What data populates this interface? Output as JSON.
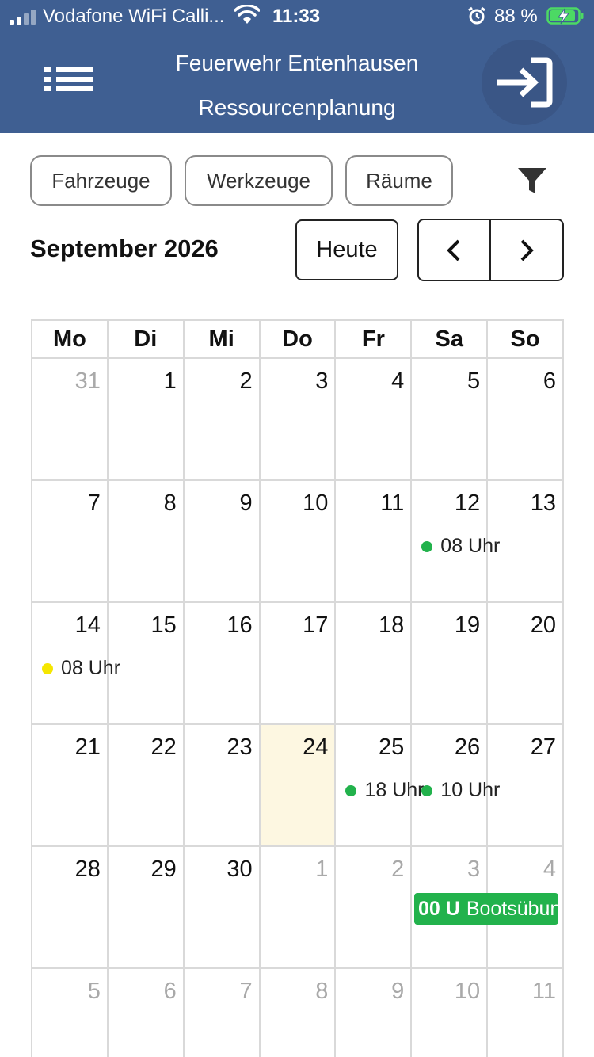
{
  "status_bar": {
    "carrier": "Vodafone WiFi Calli...",
    "time": "11:33",
    "battery": "88 %"
  },
  "header": {
    "org_name": "Feuerwehr Entenhausen",
    "app_title": "Ressourcenplanung",
    "icons": {
      "menu": "list-icon",
      "login": "sign-in-icon"
    },
    "color": "#3f5f92"
  },
  "filters": {
    "chips": [
      "Fahrzeuge",
      "Werkzeuge",
      "Räume"
    ],
    "filter_icon": "funnel-icon"
  },
  "calendar": {
    "month_label": "September 2026",
    "today_button": "Heute",
    "weekdays": [
      "Mo",
      "Di",
      "Mi",
      "Do",
      "Fr",
      "Sa",
      "So"
    ],
    "weeks": [
      [
        "31",
        "1",
        "2",
        "3",
        "4",
        "5",
        "6"
      ],
      [
        "7",
        "8",
        "9",
        "10",
        "11",
        "12",
        "13"
      ],
      [
        "14",
        "15",
        "16",
        "17",
        "18",
        "19",
        "20"
      ],
      [
        "21",
        "22",
        "23",
        "24",
        "25",
        "26",
        "27"
      ],
      [
        "28",
        "29",
        "30",
        "1",
        "2",
        "3",
        "4"
      ],
      [
        "5",
        "6",
        "7",
        "8",
        "9",
        "10",
        "11"
      ]
    ],
    "today": "24",
    "events": {
      "sat_12": {
        "time": "08 Uhr",
        "color": "#22b24c"
      },
      "mon_14": {
        "time": "08 Uhr",
        "color": "#f5e600"
      },
      "fri_25": {
        "time": "18 Uhr",
        "color": "#22b24c"
      },
      "sat_26": {
        "time": "10 Uhr",
        "color": "#22b24c"
      },
      "oct_3": {
        "time": "00 U",
        "title": "Bootsübun",
        "color": "#22b24c"
      }
    },
    "today_color": "#fdf7e1"
  }
}
